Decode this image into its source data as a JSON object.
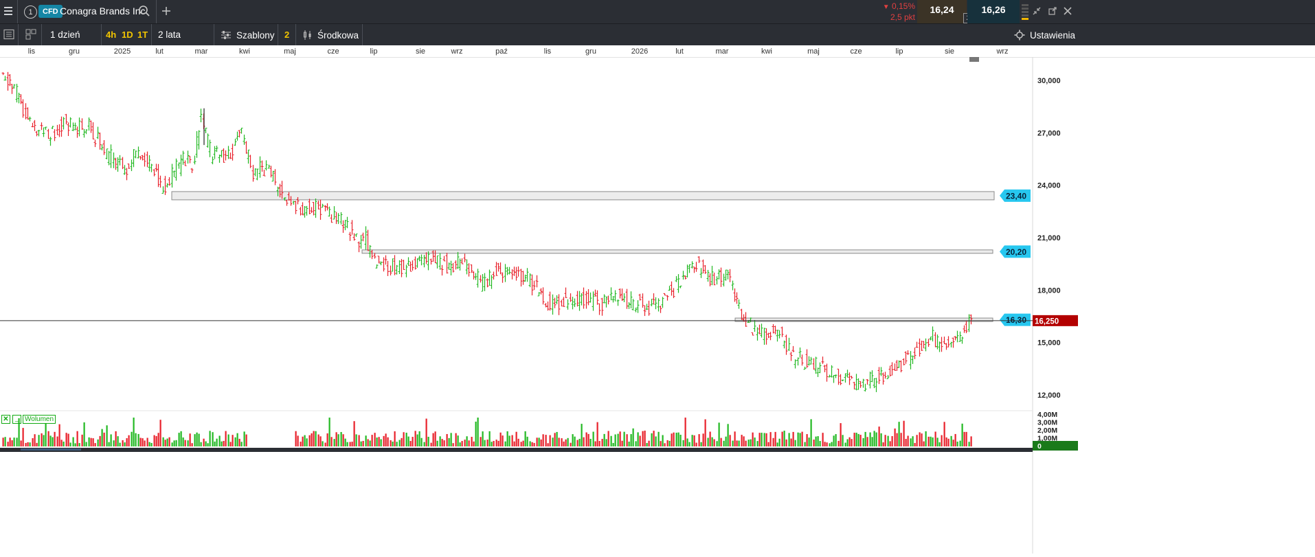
{
  "header": {
    "tab_number": "1",
    "instrument_type": "CFD",
    "instrument_name": "Conagra Brands Inc",
    "change_percent": "0,15%",
    "change_points": "2,5 pkt",
    "sell_price": "16,24",
    "buy_price": "16,26",
    "spread": "2"
  },
  "toolbar": {
    "interval": "1 dzień",
    "quick_intervals": [
      "4h",
      "1D",
      "1T"
    ],
    "range": "2 lata",
    "templates_label": "Szablony",
    "templates_count": "2",
    "chart_type_label": "Środkowa",
    "settings_label": "Ustawienia"
  },
  "time_axis": [
    "lis",
    "gru",
    "2025",
    "lut",
    "mar",
    "kwi",
    "maj",
    "cze",
    "lip",
    "sie",
    "wrz",
    "paź",
    "lis",
    "gru",
    "2026",
    "lut",
    "mar",
    "kwi",
    "maj",
    "cze",
    "lip",
    "sie",
    "wrz"
  ],
  "price_axis": [
    "30,000",
    "27,000",
    "24,000",
    "21,000",
    "18,000",
    "15,000",
    "12,000"
  ],
  "volume_axis": [
    "4,00M",
    "3,00M",
    "2,00M",
    "1,00M",
    "0"
  ],
  "volume_label": "Wolumen",
  "levels": [
    {
      "label": "23,40",
      "value": 23.4
    },
    {
      "label": "20,20",
      "value": 20.2
    },
    {
      "label": "16,30",
      "value": 16.3
    }
  ],
  "current_price_label": "16,250",
  "current_price": 16.25,
  "colors": {
    "up": "#22b822",
    "down": "#e8202a",
    "level_tag": "#27c7ef",
    "current_tag": "#b30000",
    "background_bar": "#2b2e34",
    "sell_box": "#3b3326",
    "buy_box": "#17313c"
  },
  "chart_data": {
    "type": "ohlc",
    "ylim": [
      11.5,
      31.5
    ],
    "anchors": [
      [
        0,
        30.4
      ],
      [
        10,
        29.5
      ],
      [
        20,
        28.2
      ],
      [
        32,
        27.1
      ],
      [
        42,
        26.9
      ],
      [
        55,
        27.6
      ],
      [
        65,
        27.3
      ],
      [
        75,
        27.5
      ],
      [
        85,
        26.5
      ],
      [
        100,
        25.3
      ],
      [
        110,
        25.0
      ],
      [
        120,
        26.0
      ],
      [
        132,
        25.0
      ],
      [
        145,
        23.7
      ],
      [
        150,
        24.6
      ],
      [
        160,
        25.5
      ],
      [
        170,
        25.2
      ],
      [
        175,
        28.0
      ],
      [
        185,
        25.8
      ],
      [
        200,
        25.6
      ],
      [
        212,
        27.0
      ],
      [
        222,
        24.8
      ],
      [
        235,
        25.0
      ],
      [
        250,
        23.4
      ],
      [
        265,
        22.6
      ],
      [
        278,
        22.8
      ],
      [
        290,
        22.4
      ],
      [
        305,
        21.6
      ],
      [
        318,
        20.6
      ],
      [
        322,
        21.0
      ],
      [
        330,
        19.7
      ],
      [
        345,
        19.4
      ],
      [
        360,
        19.2
      ],
      [
        375,
        19.8
      ],
      [
        395,
        19.4
      ],
      [
        410,
        19.5
      ],
      [
        425,
        18.4
      ],
      [
        445,
        19.2
      ],
      [
        465,
        18.8
      ],
      [
        485,
        17.2
      ],
      [
        500,
        17.4
      ],
      [
        515,
        17.6
      ],
      [
        530,
        17.2
      ],
      [
        545,
        17.8
      ],
      [
        560,
        17.3
      ],
      [
        575,
        17.0
      ],
      [
        590,
        17.6
      ],
      [
        603,
        18.6
      ],
      [
        612,
        19.7
      ],
      [
        620,
        19.2
      ],
      [
        630,
        18.6
      ],
      [
        645,
        18.9
      ],
      [
        655,
        16.8
      ],
      [
        670,
        15.4
      ],
      [
        690,
        15.6
      ],
      [
        700,
        14.2
      ],
      [
        720,
        13.8
      ],
      [
        740,
        13.2
      ],
      [
        760,
        12.5
      ],
      [
        775,
        13.0
      ],
      [
        790,
        13.4
      ],
      [
        805,
        14.2
      ],
      [
        815,
        14.8
      ],
      [
        825,
        15.3
      ],
      [
        840,
        14.8
      ],
      [
        850,
        15.3
      ],
      [
        860,
        16.3
      ]
    ],
    "bars": 861,
    "first_visible_bar": 0,
    "volume_gap": [
      360,
      430
    ]
  }
}
